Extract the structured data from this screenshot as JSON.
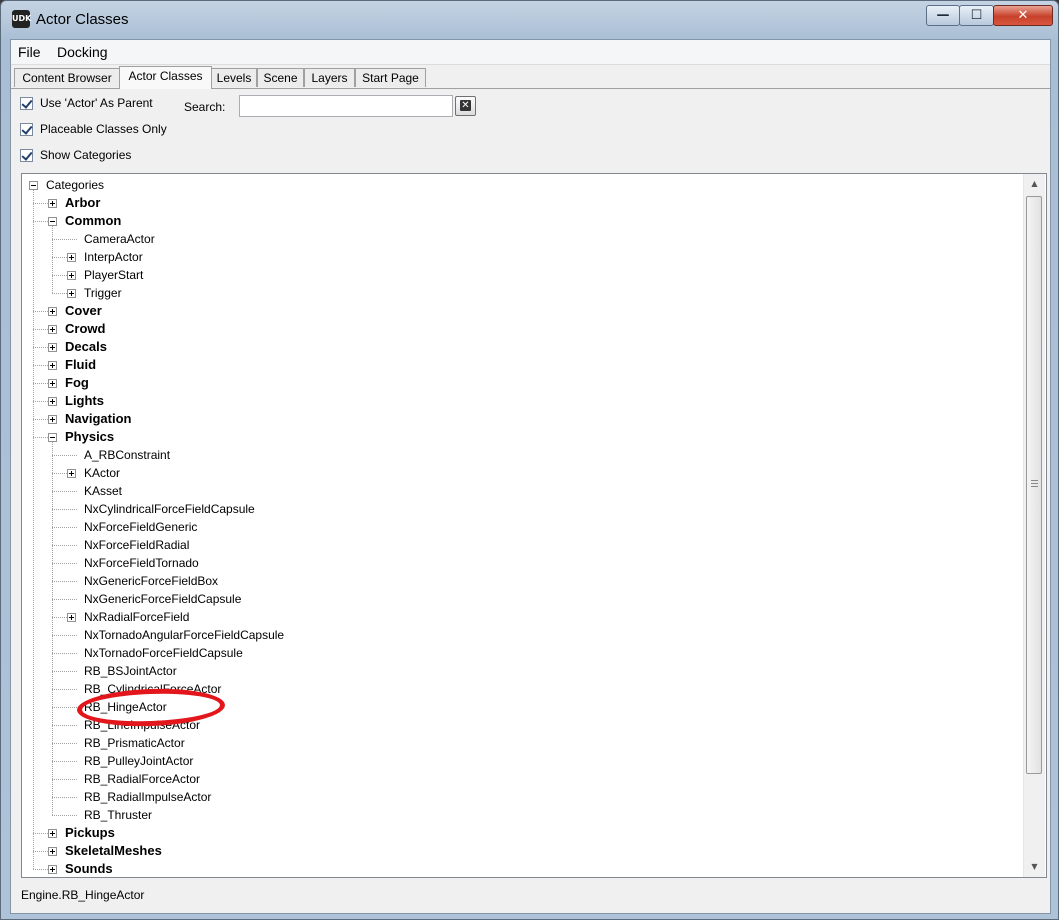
{
  "window": {
    "title": "Actor Classes",
    "app_icon_label": "UDK",
    "minimize": "—",
    "maximize": "☐",
    "close": "✕"
  },
  "menu": [
    "File",
    "Docking"
  ],
  "tabs": [
    "Content Browser",
    "Actor Classes",
    "Levels",
    "Scene",
    "Layers",
    "Start Page"
  ],
  "active_tab": "Actor Classes",
  "options": {
    "use_actor_parent": "Use 'Actor' As Parent",
    "placeable_only": "Placeable Classes Only",
    "show_categories": "Show Categories"
  },
  "search": {
    "label": "Search:",
    "value": "",
    "clear_icon": "✕"
  },
  "tree": [
    {
      "label": "Categories",
      "depth": 0,
      "expander": "minus",
      "bold": false
    },
    {
      "label": "Arbor",
      "depth": 1,
      "expander": "plus",
      "bold": true
    },
    {
      "label": "Common",
      "depth": 1,
      "expander": "minus",
      "bold": true
    },
    {
      "label": "CameraActor",
      "depth": 2,
      "expander": "none",
      "bold": false
    },
    {
      "label": "InterpActor",
      "depth": 2,
      "expander": "plus",
      "bold": false
    },
    {
      "label": "PlayerStart",
      "depth": 2,
      "expander": "plus",
      "bold": false
    },
    {
      "label": "Trigger",
      "depth": 2,
      "expander": "plus",
      "bold": false
    },
    {
      "label": "Cover",
      "depth": 1,
      "expander": "plus",
      "bold": true
    },
    {
      "label": "Crowd",
      "depth": 1,
      "expander": "plus",
      "bold": true
    },
    {
      "label": "Decals",
      "depth": 1,
      "expander": "plus",
      "bold": true
    },
    {
      "label": "Fluid",
      "depth": 1,
      "expander": "plus",
      "bold": true
    },
    {
      "label": "Fog",
      "depth": 1,
      "expander": "plus",
      "bold": true
    },
    {
      "label": "Lights",
      "depth": 1,
      "expander": "plus",
      "bold": true
    },
    {
      "label": "Navigation",
      "depth": 1,
      "expander": "plus",
      "bold": true
    },
    {
      "label": "Physics",
      "depth": 1,
      "expander": "minus",
      "bold": true
    },
    {
      "label": "A_RBConstraint",
      "depth": 2,
      "expander": "none",
      "bold": false
    },
    {
      "label": "KActor",
      "depth": 2,
      "expander": "plus",
      "bold": false
    },
    {
      "label": "KAsset",
      "depth": 2,
      "expander": "none",
      "bold": false
    },
    {
      "label": "NxCylindricalForceFieldCapsule",
      "depth": 2,
      "expander": "none",
      "bold": false
    },
    {
      "label": "NxForceFieldGeneric",
      "depth": 2,
      "expander": "none",
      "bold": false
    },
    {
      "label": "NxForceFieldRadial",
      "depth": 2,
      "expander": "none",
      "bold": false
    },
    {
      "label": "NxForceFieldTornado",
      "depth": 2,
      "expander": "none",
      "bold": false
    },
    {
      "label": "NxGenericForceFieldBox",
      "depth": 2,
      "expander": "none",
      "bold": false
    },
    {
      "label": "NxGenericForceFieldCapsule",
      "depth": 2,
      "expander": "none",
      "bold": false
    },
    {
      "label": "NxRadialForceField",
      "depth": 2,
      "expander": "plus",
      "bold": false
    },
    {
      "label": "NxTornadoAngularForceFieldCapsule",
      "depth": 2,
      "expander": "none",
      "bold": false
    },
    {
      "label": "NxTornadoForceFieldCapsule",
      "depth": 2,
      "expander": "none",
      "bold": false
    },
    {
      "label": "RB_BSJointActor",
      "depth": 2,
      "expander": "none",
      "bold": false
    },
    {
      "label": "RB_CylindricalForceActor",
      "depth": 2,
      "expander": "none",
      "bold": false
    },
    {
      "label": "RB_HingeActor",
      "depth": 2,
      "expander": "none",
      "bold": false
    },
    {
      "label": "RB_LineImpulseActor",
      "depth": 2,
      "expander": "none",
      "bold": false
    },
    {
      "label": "RB_PrismaticActor",
      "depth": 2,
      "expander": "none",
      "bold": false
    },
    {
      "label": "RB_PulleyJointActor",
      "depth": 2,
      "expander": "none",
      "bold": false
    },
    {
      "label": "RB_RadialForceActor",
      "depth": 2,
      "expander": "none",
      "bold": false
    },
    {
      "label": "RB_RadialImpulseActor",
      "depth": 2,
      "expander": "none",
      "bold": false
    },
    {
      "label": "RB_Thruster",
      "depth": 2,
      "expander": "none",
      "bold": false
    },
    {
      "label": "Pickups",
      "depth": 1,
      "expander": "plus",
      "bold": true
    },
    {
      "label": "SkeletalMeshes",
      "depth": 1,
      "expander": "plus",
      "bold": true
    },
    {
      "label": "Sounds",
      "depth": 1,
      "expander": "plus",
      "bold": true
    }
  ],
  "highlighted_item": "RB_HingeActor",
  "highlight_color": "#e3161b",
  "status": "Engine.RB_HingeActor"
}
